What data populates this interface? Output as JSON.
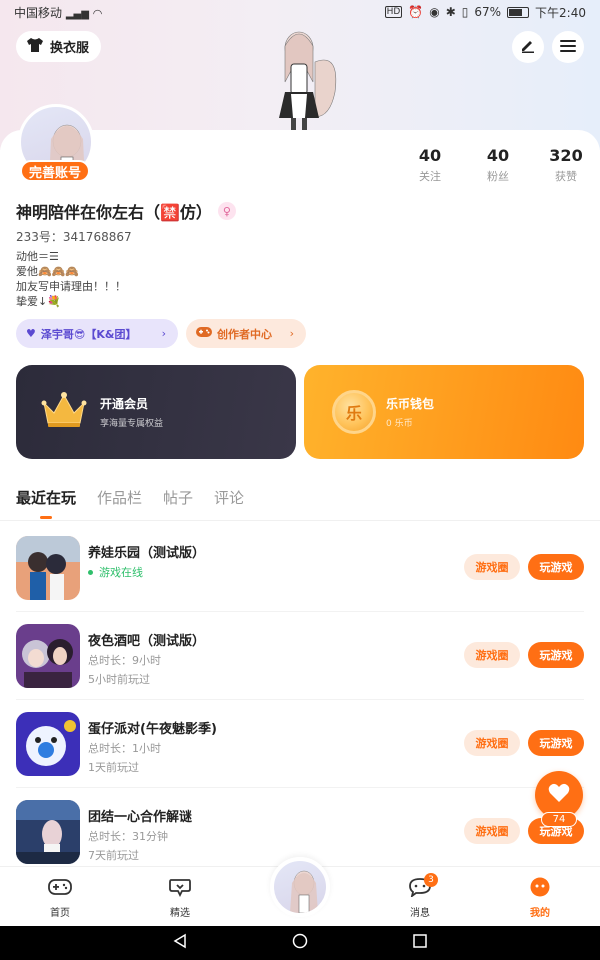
{
  "status_bar": {
    "carrier": "中国移动",
    "battery": "67%",
    "time": "下午2:40"
  },
  "header": {
    "wardrobe_label": "换衣服",
    "edit_icon": "pencil-icon",
    "menu_icon": "hamburger-menu-icon"
  },
  "profile": {
    "complete_badge": "完善账号",
    "name": "神明陪伴在你左右（🈲仿）",
    "gender_icon": "female-icon",
    "uid": "233号：341768867",
    "bio_lines": [
      "动他＝☰",
      "爱他🙈🙈🙈",
      "加友写申请理由！！！",
      "挚爱↓💐"
    ],
    "stats": [
      {
        "num": "40",
        "label": "关注"
      },
      {
        "num": "40",
        "label": "粉丝"
      },
      {
        "num": "320",
        "label": "获赞"
      }
    ],
    "tags": {
      "club": "泽宇哥😎【K&团】",
      "creator": "创作者中心"
    }
  },
  "cards": {
    "vip_title": "开通会员",
    "vip_sub": "享海量专属权益",
    "wallet_title": "乐币钱包",
    "wallet_sub": "0 乐币",
    "coin_char": "乐"
  },
  "tabs": [
    "最近在玩",
    "作品栏",
    "帖子",
    "评论"
  ],
  "games": [
    {
      "name": "养娃乐园（测试版）",
      "meta1": "游戏在线",
      "meta2": "",
      "online": true
    },
    {
      "name": "夜色酒吧（测试版）",
      "meta1": "总时长：9小时",
      "meta2": "5小时前玩过",
      "online": false
    },
    {
      "name": "蛋仔派对(午夜魅影季)",
      "meta1": "总时长：1小时",
      "meta2": "1天前玩过",
      "online": false
    },
    {
      "name": "团结一心合作解谜",
      "meta1": "总时长：31分钟",
      "meta2": "7天前玩过",
      "online": false
    }
  ],
  "game_buttons": {
    "circle": "游戏圈",
    "play": "玩游戏"
  },
  "like_fab": {
    "count": "74"
  },
  "bottom_nav": {
    "home": "首页",
    "featured": "精选",
    "messages": "消息",
    "messages_badge": "3",
    "mine": "我的"
  },
  "colors": {
    "accent": "#ff6f14",
    "online": "#2fbf6b"
  }
}
